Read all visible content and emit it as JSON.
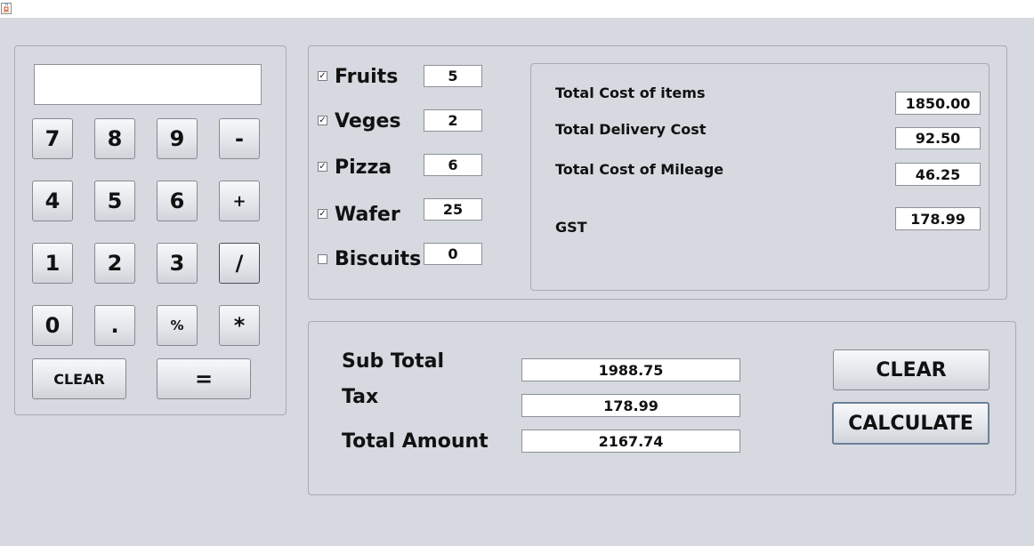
{
  "window": {
    "icon": "java-coffee-icon"
  },
  "calculator": {
    "display_value": "",
    "keys": {
      "k7": "7",
      "k8": "8",
      "k9": "9",
      "minus": "-",
      "k4": "4",
      "k5": "5",
      "k6": "6",
      "plus": "+",
      "k1": "1",
      "k2": "2",
      "k3": "3",
      "divide": "/",
      "k0": "0",
      "dot": ".",
      "percent": "%",
      "multiply": "*",
      "clear": "CLEAR",
      "equals": "="
    }
  },
  "items": [
    {
      "label": "Fruits",
      "checked": true,
      "qty": "5"
    },
    {
      "label": "Veges",
      "checked": true,
      "qty": "2"
    },
    {
      "label": "Pizza",
      "checked": true,
      "qty": "6"
    },
    {
      "label": "Wafer",
      "checked": true,
      "qty": "25"
    },
    {
      "label": "Biscuits",
      "checked": false,
      "qty": "0"
    }
  ],
  "costs": {
    "total_items_label": "Total Cost of items",
    "total_items_value": "1850.00",
    "delivery_label": "Total Delivery Cost",
    "delivery_value": "92.50",
    "mileage_label": "Total Cost of Mileage",
    "mileage_value": "46.25",
    "gst_label": "GST",
    "gst_value": "178.99"
  },
  "summary": {
    "subtotal_label": "Sub Total",
    "subtotal_value": "1988.75",
    "tax_label": "Tax",
    "tax_value": "178.99",
    "total_label": "Total Amount",
    "total_value": "2167.74",
    "clear_label": "CLEAR",
    "calculate_label": "CALCULATE"
  }
}
